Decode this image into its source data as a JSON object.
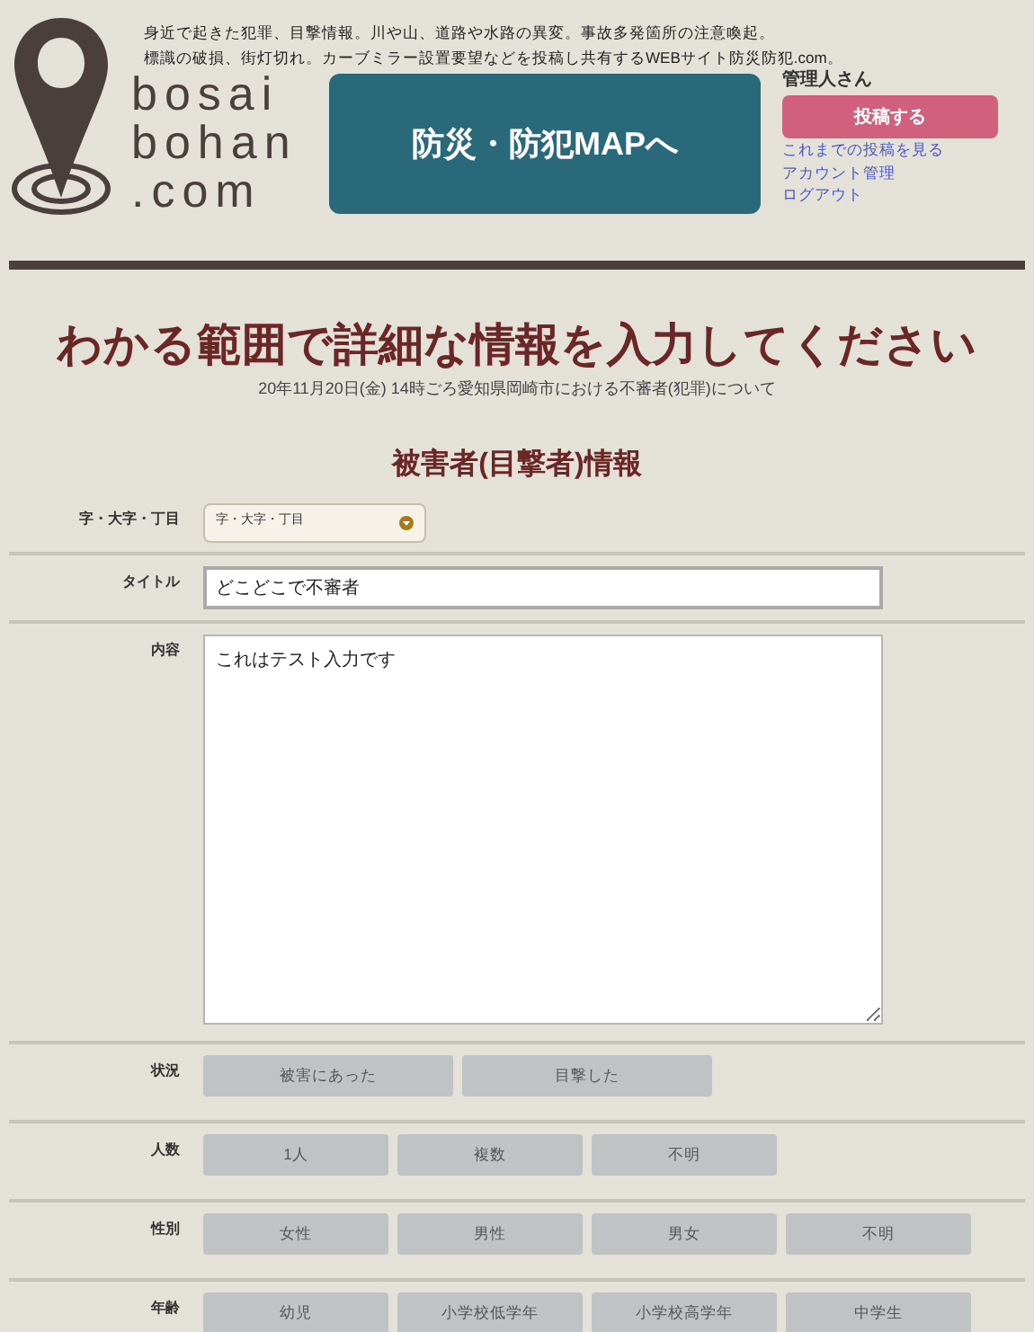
{
  "header": {
    "logo_lines": [
      "bosai",
      "bohan",
      ".com"
    ],
    "tagline": [
      "身近で起きた犯罪、目撃情報。川や山、道路や水路の異変。事故多発箇所の注意喚起。",
      "標識の破損、街灯切れ。カーブミラー設置要望などを投稿し共有するWEBサイト防災防犯.com。"
    ],
    "map_button": "防災・防犯MAPへ",
    "user": "管理人さん",
    "post_button": "投稿する",
    "links": [
      "これまでの投稿を見る",
      "アカウント管理",
      "ログアウト"
    ]
  },
  "page_title": "わかる範囲で詳細な情報を入力してください",
  "subtitle": "20年11月20日(金) 14時ごろ愛知県岡崎市における不審者(犯罪)について",
  "section_title": "被害者(目撃者)情報",
  "fields": [
    {
      "kind": "select",
      "label": "字・大字・丁目",
      "value": "字・大字・丁目"
    },
    {
      "kind": "text",
      "label": "タイトル",
      "value": "どこどこで不審者"
    },
    {
      "kind": "textarea",
      "label": "内容",
      "value": "これはテスト入力です"
    },
    {
      "kind": "choices",
      "label": "状況",
      "options": [
        {
          "label": "被害にあった",
          "selected": false
        },
        {
          "label": "目撃した",
          "selected": false
        }
      ]
    },
    {
      "kind": "choices",
      "label": "人数",
      "options": [
        {
          "label": "1人",
          "selected": false
        },
        {
          "label": "複数",
          "selected": false
        },
        {
          "label": "不明",
          "selected": false
        }
      ]
    },
    {
      "kind": "choices",
      "label": "性別",
      "options": [
        {
          "label": "女性",
          "selected": false
        },
        {
          "label": "男性",
          "selected": false
        },
        {
          "label": "男女",
          "selected": false
        },
        {
          "label": "不明",
          "selected": false
        }
      ]
    },
    {
      "kind": "choices",
      "label": "年齢",
      "options": [
        {
          "label": "幼児",
          "selected": false
        },
        {
          "label": "小学校低学年",
          "selected": false
        },
        {
          "label": "小学校高学年",
          "selected": false
        },
        {
          "label": "中学生",
          "selected": false
        }
      ]
    }
  ]
}
